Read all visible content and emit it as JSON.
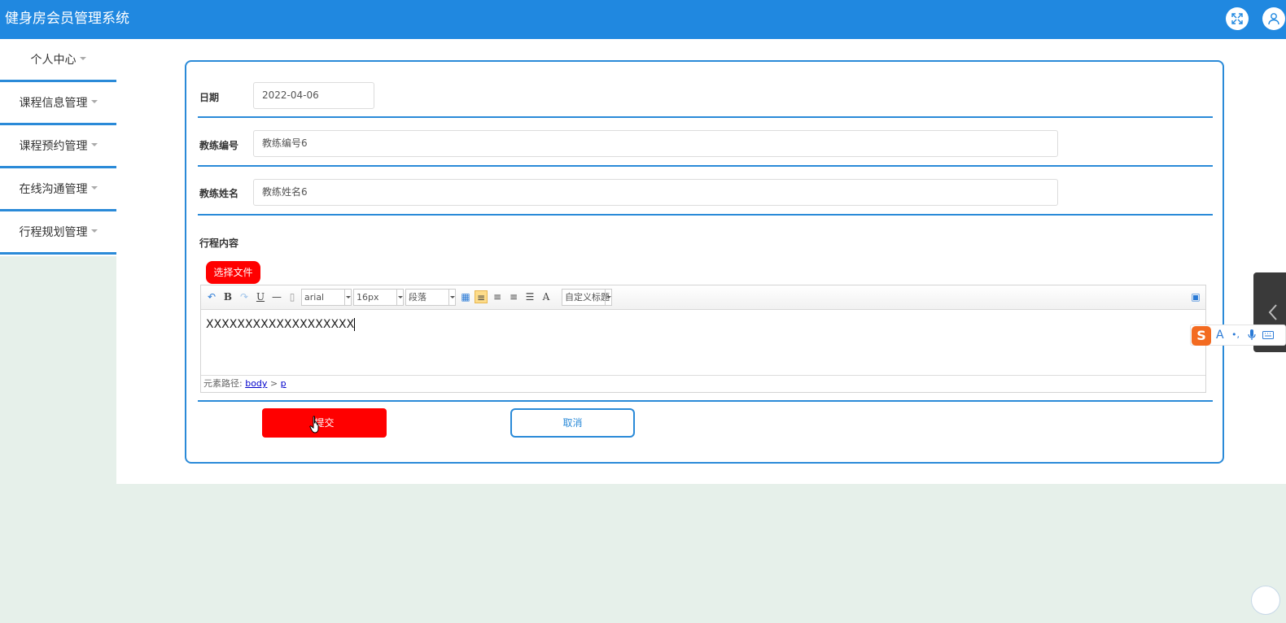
{
  "header": {
    "title": "健身房会员管理系统",
    "bg_color": "#2088e0",
    "expand_icon": "fullscreen-icon",
    "user_icon": "user-icon"
  },
  "sidebar": {
    "items": [
      {
        "label": "个人中心"
      },
      {
        "label": "课程信息管理"
      },
      {
        "label": "课程预约管理"
      },
      {
        "label": "在线沟通管理"
      },
      {
        "label": "行程规划管理"
      }
    ],
    "accent_color": "#2a8ad8"
  },
  "form": {
    "date": {
      "label": "日期",
      "value": "2022-04-06"
    },
    "coach_id": {
      "label": "教练编号",
      "value": "教练编号6"
    },
    "coach_name": {
      "label": "教练姓名",
      "value": "教练姓名6"
    },
    "itinerary": {
      "label": "行程内容"
    },
    "choose_file_label": "选择文件",
    "editor": {
      "font_family": "arial",
      "font_size": "16px",
      "paragraph": "段落",
      "custom_title": "自定义标题",
      "content": "XXXXXXXXXXXXXXXXXXX",
      "path_label": "元素路径:",
      "path_body": "body",
      "path_sep": ">",
      "path_p": "p"
    },
    "submit_label": "提交",
    "cancel_label": "取消",
    "submit_color": "#ff0000"
  },
  "ime": {
    "logo": "S",
    "items": [
      "A",
      "•,",
      "mic-icon",
      "keyboard-icon"
    ]
  }
}
